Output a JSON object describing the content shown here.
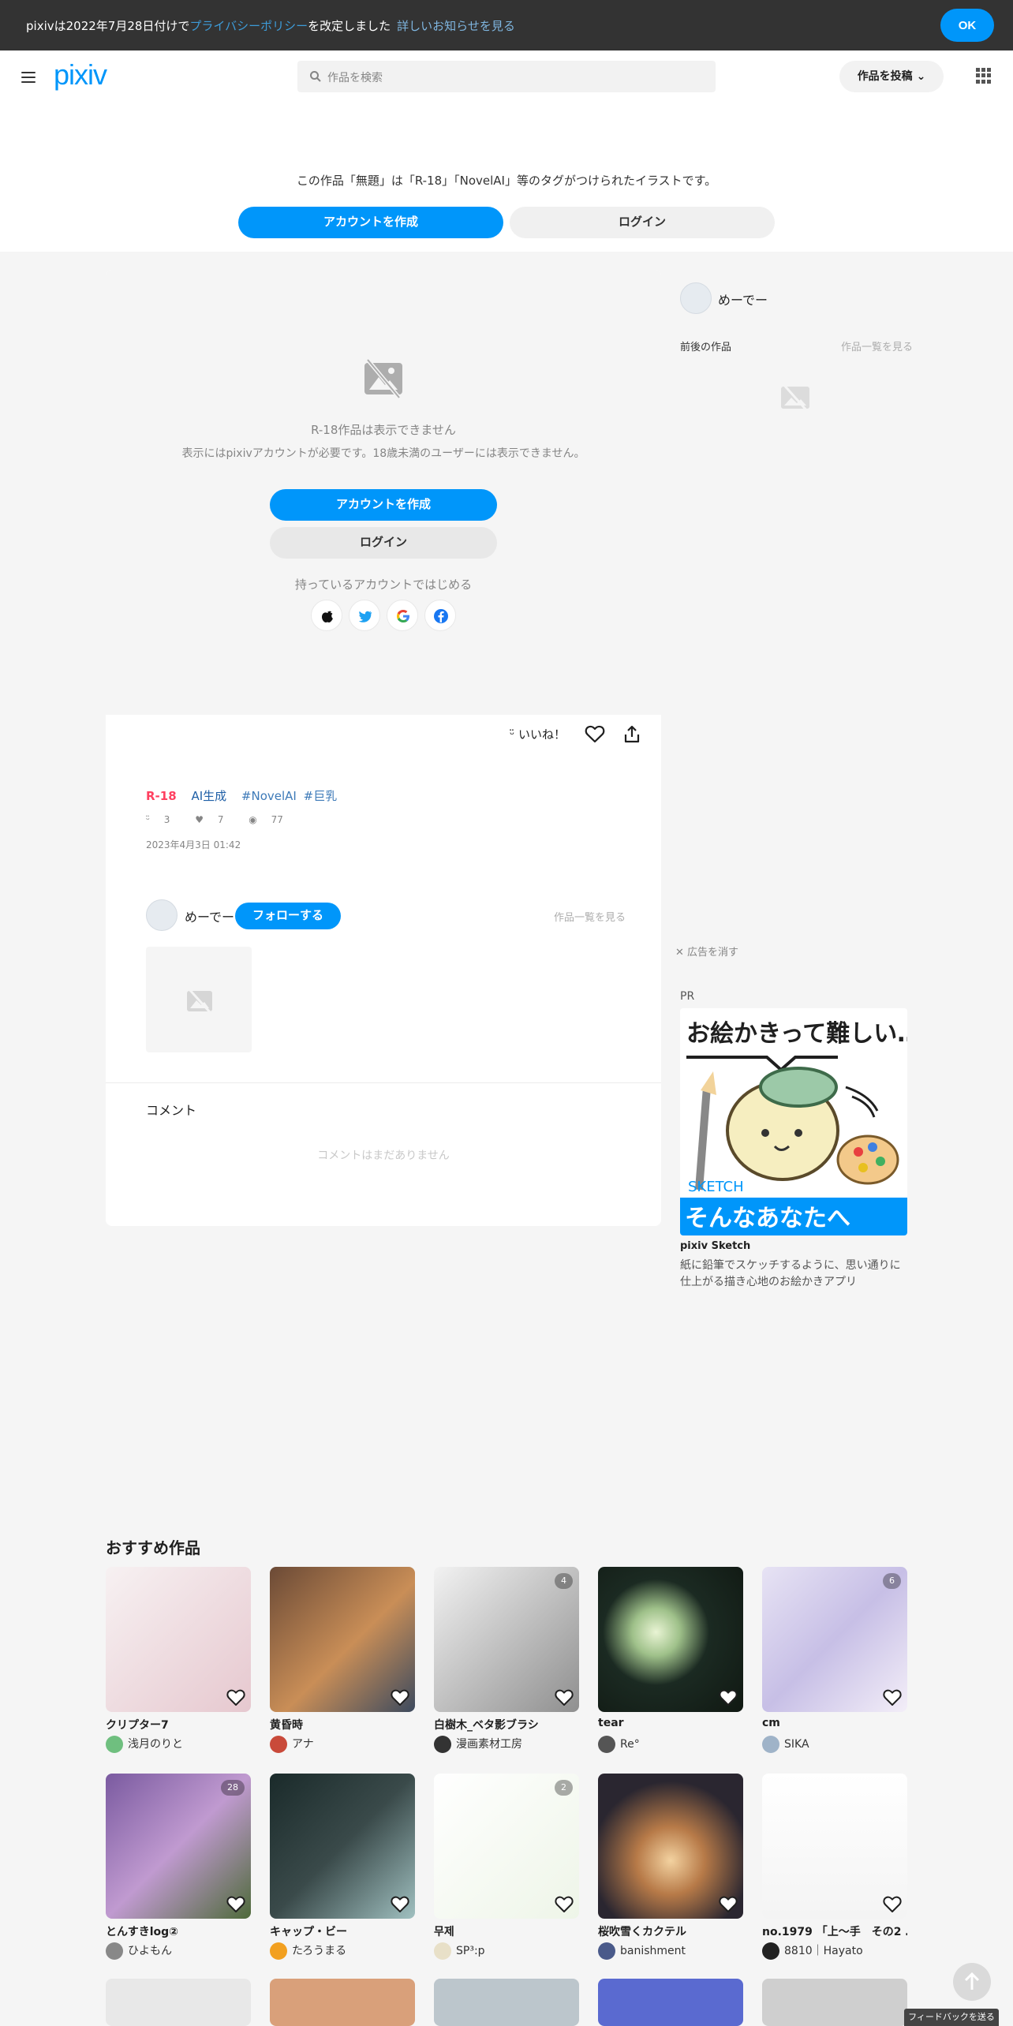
{
  "notice": {
    "text_before": "pixivは2022年7月28日付けで",
    "link": "プライバシーポリシー",
    "text_after": "を改定しました",
    "more": "詳しいお知らせを見る",
    "ok": "OK"
  },
  "header": {
    "logo": "pixiv",
    "search_placeholder": "作品を検索",
    "post_button": "作品を投稿"
  },
  "gate_banner": {
    "text": "この作品「無題」は「R-18」「NovelAI」等のタグがつけられたイラストです。",
    "create": "アカウントを作成",
    "login": "ログイン"
  },
  "artwork": {
    "restricted_title": "R-18作品は表示できません",
    "restricted_desc": "表示にはpixivアカウントが必要です。18歳未満のユーザーには表示できません。",
    "create": "アカウントを作成",
    "login": "ログイン",
    "existing": "持っているアカウントではじめる",
    "like_label": "いいね！",
    "tags": [
      "R-18",
      "AI生成",
      "#NovelAI",
      "#巨乳"
    ],
    "stats": {
      "likes": "3",
      "bookmarks": "7",
      "views": "77"
    },
    "date": "2023年4月3日 01:42",
    "author": "めーでー",
    "follow": "フォローする",
    "list_link": "作品一覧を見る",
    "comment_heading": "コメント",
    "comment_empty": "コメントはまだありません"
  },
  "sidebar": {
    "author": "めーでー",
    "adjacent_heading": "前後の作品",
    "list_link": "作品一覧を見る",
    "ad_close": "広告を消す",
    "pr": "PR",
    "ad_headline": "お絵かきって難しい…",
    "ad_brand": "SKETCH",
    "ad_tagline": "そんなあなたへ",
    "ad_title": "pixiv Sketch",
    "ad_desc": "紙に鉛筆でスケッチするように、思い通りに仕上がる描き心地のお絵かきアプリ"
  },
  "recommended": {
    "heading": "おすすめ作品",
    "items": [
      {
        "title": "クリプター7",
        "user": "浅月のりと",
        "count": ""
      },
      {
        "title": "黄昏時",
        "user": "アナ",
        "count": ""
      },
      {
        "title": "白樹木_ベタ影ブラシ",
        "user": "漫画素材工房",
        "count": "4"
      },
      {
        "title": "tear",
        "user": "Re°",
        "count": ""
      },
      {
        "title": "cm",
        "user": "SIKA",
        "count": "6"
      },
      {
        "title": "とんすきlog②",
        "user": "ひよもん",
        "count": "28"
      },
      {
        "title": "キャップ・ビー",
        "user": "たろうまる",
        "count": ""
      },
      {
        "title": "무제",
        "user": "SP³:p",
        "count": "2"
      },
      {
        "title": "桜吹雪くカクテル",
        "user": "banishment",
        "count": ""
      },
      {
        "title": "no.1979 「上〜手　その2 …",
        "user": "8810｜Hayato",
        "count": ""
      }
    ]
  },
  "feedback": "フィードバックを送る",
  "colors": {
    "accent": "#0096fa",
    "r18": "#ff4060",
    "notice_bg": "#333333"
  }
}
